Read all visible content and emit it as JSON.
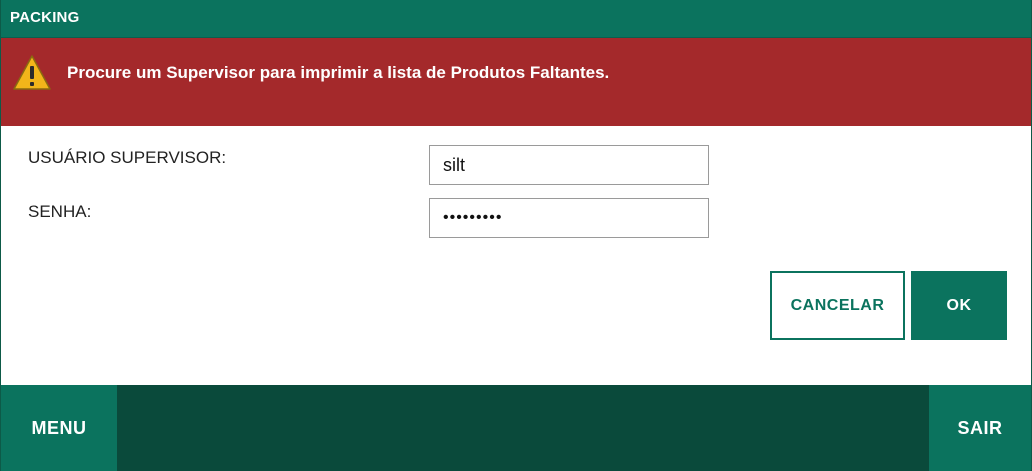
{
  "window": {
    "title": "PACKING"
  },
  "alert": {
    "icon": "warning-icon",
    "message": "Procure um Supervisor para imprimir a lista de Produtos Faltantes.",
    "color": "#a4292b"
  },
  "form": {
    "user_label": "USUÁRIO SUPERVISOR:",
    "user_value": "silt",
    "password_label": "SENHA:",
    "password_value": "•••••••••"
  },
  "actions": {
    "cancel_label": "CANCELAR",
    "ok_label": "OK"
  },
  "footer": {
    "menu_label": "MENU",
    "exit_label": "SAIR"
  },
  "colors": {
    "primary": "#0b735e",
    "footer_background": "#0a4a3b",
    "alert": "#a4292b"
  }
}
